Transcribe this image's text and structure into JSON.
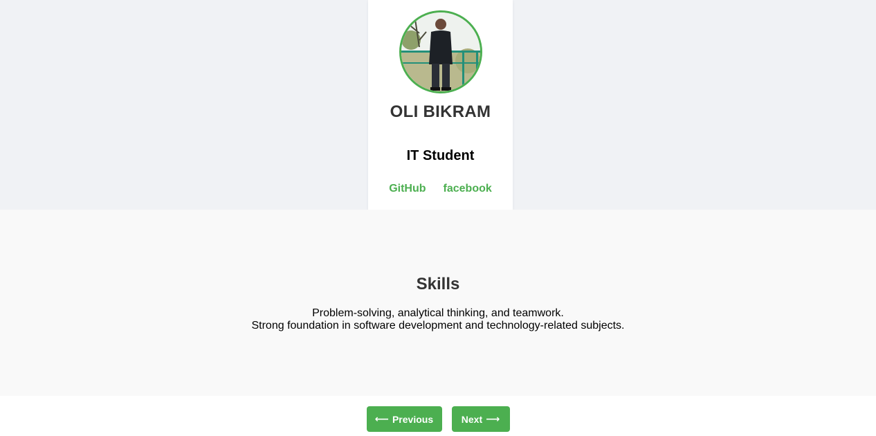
{
  "profile": {
    "name": "OLI BIKRAM",
    "role": "IT Student",
    "links": [
      {
        "label": "GitHub"
      },
      {
        "label": "facebook"
      }
    ],
    "accent_color": "#4caf50"
  },
  "skills": {
    "title": "Skills",
    "lines": [
      "Problem-solving, analytical thinking, and teamwork.",
      "Strong foundation in software development and technology-related subjects."
    ]
  },
  "navigation": {
    "previous_label": "Previous",
    "previous_icon": "arrow-left-icon",
    "next_label": "Next",
    "next_icon": "arrow-right-icon"
  }
}
